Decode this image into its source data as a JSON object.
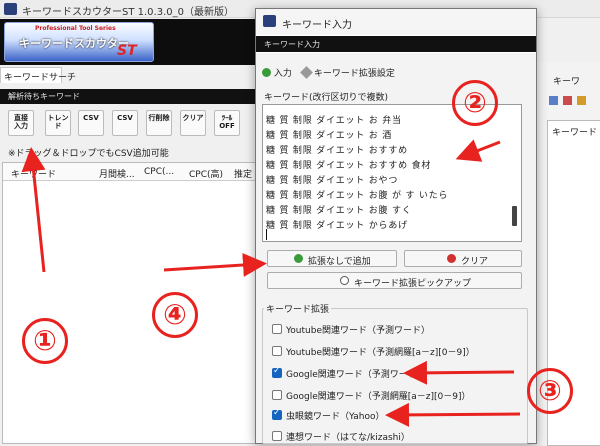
{
  "main": {
    "title": "キーワードスカウターST 1.0.3.0_0（最新版）",
    "banner": {
      "line1": "Professional Tool Series",
      "line2": "キーワードスカウター",
      "line3": "ST"
    },
    "tab": "キーワードサーチ",
    "queue_header": "解析待ちキーワード",
    "tools": [
      "直接\n入力",
      "トレンド",
      "CSV",
      "CSV",
      "行削除",
      "クリア",
      "ﾂｰﾙOFF"
    ],
    "drag_hint": "※ドラッグ＆ドロップでもCSV追加可能",
    "grid_columns": [
      "キーワード",
      "月間検...",
      "CPC(...",
      "CPC(高)",
      "推定"
    ]
  },
  "right_pane": {
    "tab": "キーワ",
    "column": "キーワード"
  },
  "dialog": {
    "title": "キーワード入力",
    "header": "キーワード入力",
    "tabs": [
      "入力",
      "キーワード拡張設定"
    ],
    "textarea_label": "キーワード(改行区切りで複数)",
    "keywords": [
      "糖 質 制限 ダイエット お 弁当",
      "糖 質 制限 ダイエット お 酒",
      "糖 質 制限 ダイエット おすすめ",
      "糖 質 制限 ダイエット おすすめ 食材",
      "糖 質 制限 ダイエット おやつ",
      "糖 質 制限 ダイエット お腹 が す いたら",
      "糖 質 制限 ダイエット お腹 すく",
      "糖 質 制限 ダイエット からあげ"
    ],
    "buttons": {
      "add_no_ext": "拡張なしで追加",
      "clear": "クリア",
      "pickup": "キーワード拡張ピックアップ"
    },
    "ext_group_title": "キーワード拡張",
    "ext_options": [
      {
        "label": "Youtube関連ワード（予測ワード）",
        "checked": false
      },
      {
        "label": "Youtube関連ワード（予測網羅[a－z][0－9]）",
        "checked": false
      },
      {
        "label": "Google関連ワード（予測ワード）",
        "checked": true
      },
      {
        "label": "Google関連ワード（予測網羅[a－z][0－9]）",
        "checked": false
      },
      {
        "label": "虫眼鏡ワード（Yahoo）",
        "checked": true
      },
      {
        "label": "連想ワード（はてな/kizashi）",
        "checked": false
      }
    ]
  },
  "annotations": [
    "①",
    "②",
    "③",
    "④"
  ],
  "colors": {
    "annotation": "#e8231f",
    "checkbox": "#1565c0",
    "header_bg": "#111111"
  }
}
